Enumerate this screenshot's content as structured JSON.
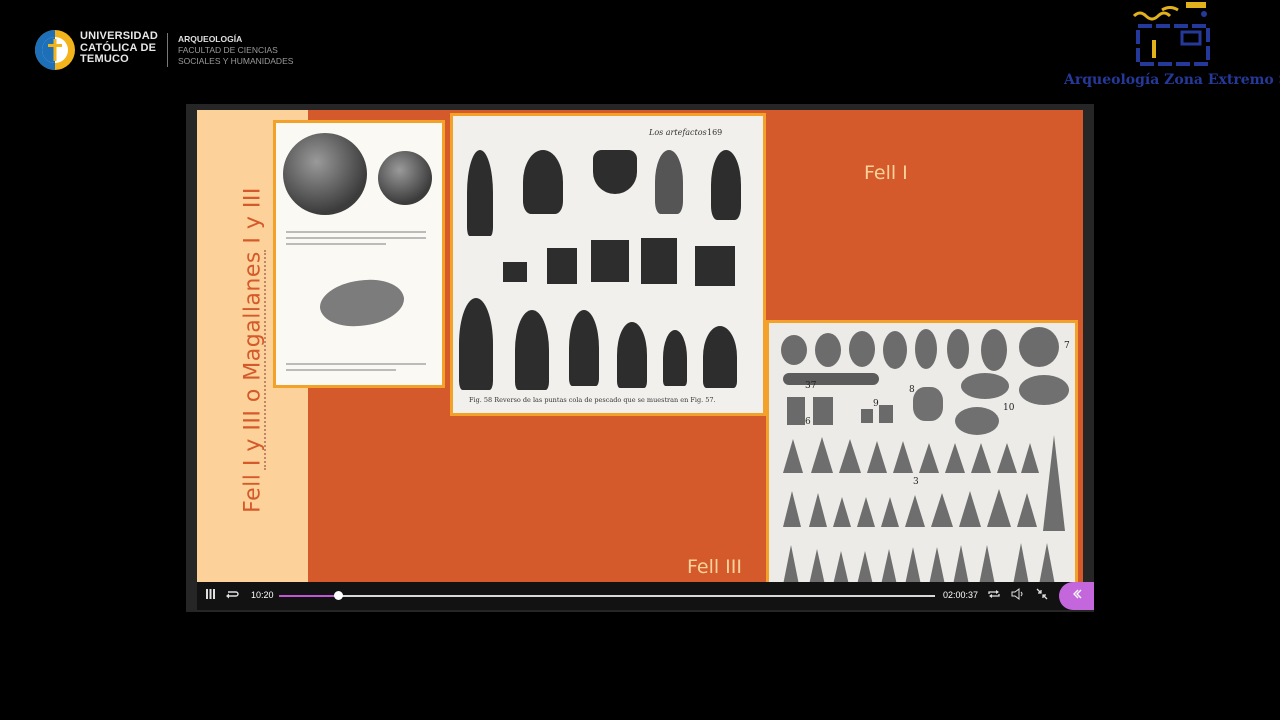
{
  "header": {
    "university_name": "UNIVERSIDAD\nCATÓLICA DE\nTEMUCO",
    "department_line1": "ARQUEOLOGÍA",
    "department_line2": "FACULTAD DE CIENCIAS",
    "department_line3": "SOCIALES Y HUMANIDADES",
    "right_logo_title": "Arqueología Zona Extremo Sur"
  },
  "slide": {
    "side_title": "Fell I y III o Magallanes I y III",
    "label_fell1": "Fell I",
    "label_fell3": "Fell III",
    "book_page_header": "Los artefactos",
    "book_page_number": "169",
    "book_fig_caption": "Fig. 58   Reverso de las puntas cola de pescado que se muestran en Fig. 57.",
    "fig_numbers": [
      "7",
      "37",
      "8",
      "10",
      "6",
      "9",
      "3"
    ]
  },
  "player": {
    "current_time": "10:20",
    "total_time": "02:00:37",
    "progress": 0.09,
    "accent_color": "#c058d6",
    "icons": [
      "pause-icon",
      "replay-icon",
      "loop-icon",
      "volume-icon",
      "exit-fullscreen-icon",
      "chevron-left-icon"
    ]
  }
}
